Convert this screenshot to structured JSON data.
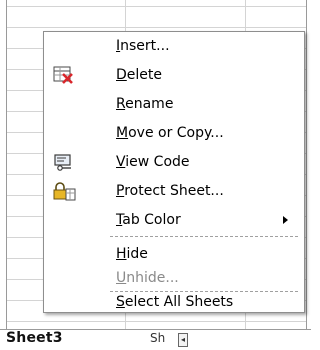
{
  "menu": {
    "items": [
      {
        "id": "insert",
        "mnemonic": "I",
        "rest": "nsert...",
        "icon": "none",
        "enabled": true
      },
      {
        "id": "delete",
        "mnemonic": "D",
        "rest": "elete",
        "icon": "delete-sheet-icon",
        "enabled": true
      },
      {
        "id": "rename",
        "mnemonic": "R",
        "rest": "ename",
        "icon": "none",
        "enabled": true
      },
      {
        "id": "move-or-copy",
        "mnemonic": "M",
        "rest": "ove or Copy...",
        "icon": "none",
        "enabled": true
      },
      {
        "id": "view-code",
        "mnemonic": "V",
        "rest": "iew Code",
        "icon": "view-code-icon",
        "enabled": true
      },
      {
        "id": "protect-sheet",
        "mnemonic": "P",
        "rest": "rotect Sheet...",
        "icon": "lock-sheet-icon",
        "enabled": true
      },
      {
        "id": "tab-color",
        "mnemonic": "T",
        "rest": "ab Color",
        "icon": "none",
        "enabled": true,
        "has_submenu": true
      },
      {
        "id": "hide",
        "mnemonic": "H",
        "rest": "ide",
        "icon": "none",
        "enabled": true
      },
      {
        "id": "unhide",
        "mnemonic": "U",
        "rest": "nhide...",
        "icon": "none",
        "enabled": false
      },
      {
        "id": "select-all-sheets",
        "mnemonic": "S",
        "rest": "elect All Sheets",
        "icon": "none",
        "enabled": true
      }
    ]
  },
  "sheet_tabs": {
    "active": "Sheet3",
    "next": "Sh"
  },
  "colors": {
    "menu_border": "#8e8e8e",
    "disabled_text": "#8a8a8a",
    "delete_icon_red": "#d9262b"
  }
}
